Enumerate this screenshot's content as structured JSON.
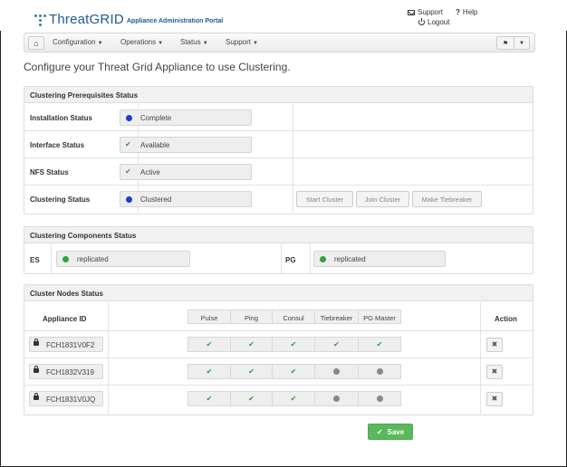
{
  "header": {
    "logo_main": "ThreatGRID",
    "logo_sub": "Appliance Administration Portal",
    "support_label": "Support",
    "help_label": "Help",
    "logout_label": "Logout"
  },
  "nav": {
    "items": [
      {
        "label": "Configuration"
      },
      {
        "label": "Operations"
      },
      {
        "label": "Status"
      },
      {
        "label": "Support"
      }
    ]
  },
  "page_title": "Configure your Threat Grid Appliance to use Clustering.",
  "prereq": {
    "title": "Clustering Prerequisites Status",
    "rows": [
      {
        "label": "Installation Status",
        "value": "Complete",
        "indicator": "blue-dot"
      },
      {
        "label": "Interface Status",
        "value": "Available",
        "indicator": "check"
      },
      {
        "label": "NFS Status",
        "value": "Active",
        "indicator": "check"
      },
      {
        "label": "Clustering Status",
        "value": "Clustered",
        "indicator": "blue-dot"
      }
    ],
    "buttons": {
      "start": "Start Cluster",
      "join": "Join Cluster",
      "tiebreaker": "Make Tiebreaker"
    }
  },
  "components": {
    "title": "Clustering Components Status",
    "es_label": "ES",
    "es_value": "replicated",
    "pg_label": "PG",
    "pg_value": "replicated"
  },
  "nodes": {
    "title": "Cluster Nodes Status",
    "id_header": "Appliance ID",
    "action_header": "Action",
    "columns": [
      "Pulse",
      "Ping",
      "Consul",
      "Tiebreaker",
      "PG Master"
    ],
    "rows": [
      {
        "id": "FCH1831V0F2",
        "status": [
          "ok",
          "ok",
          "ok",
          "ok",
          "ok"
        ]
      },
      {
        "id": "FCH1832V319",
        "status": [
          "ok",
          "ok",
          "ok",
          "off",
          "off"
        ]
      },
      {
        "id": "FCH1831V0JQ",
        "status": [
          "ok",
          "ok",
          "ok",
          "off",
          "off"
        ]
      }
    ],
    "action_icon": "✖"
  },
  "save_label": "Save",
  "colors": {
    "brand": "#1e5b96",
    "save": "#5cb85c",
    "ok": "#2e9a37",
    "blue_dot": "#1f3dcc"
  }
}
